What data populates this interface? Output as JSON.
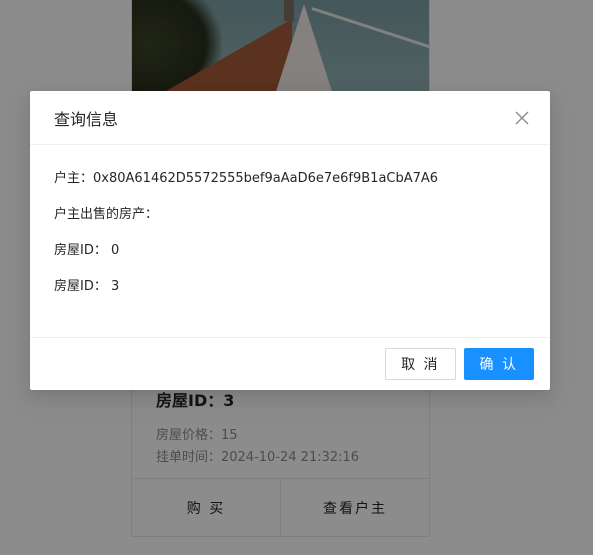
{
  "card": {
    "house_id": "房屋ID：3",
    "price": "房屋价格：15",
    "listed_time": "挂单时间：2024-10-24 21:32:16",
    "actions": {
      "buy": "购 买",
      "view_owner": "查看户主"
    }
  },
  "modal": {
    "title": "查询信息",
    "owner_line": "户主：0x80A61462D5572555bef9aAaD6e7e6f9B1aCbA7A6",
    "section_label": "户主出售的房产：",
    "houses": [
      "房屋ID： 0",
      "房屋ID： 3"
    ],
    "cancel_label": "取 消",
    "ok_label": "确 认"
  },
  "colors": {
    "primary": "#1890ff",
    "mask": "rgba(0,0,0,0.45)"
  }
}
